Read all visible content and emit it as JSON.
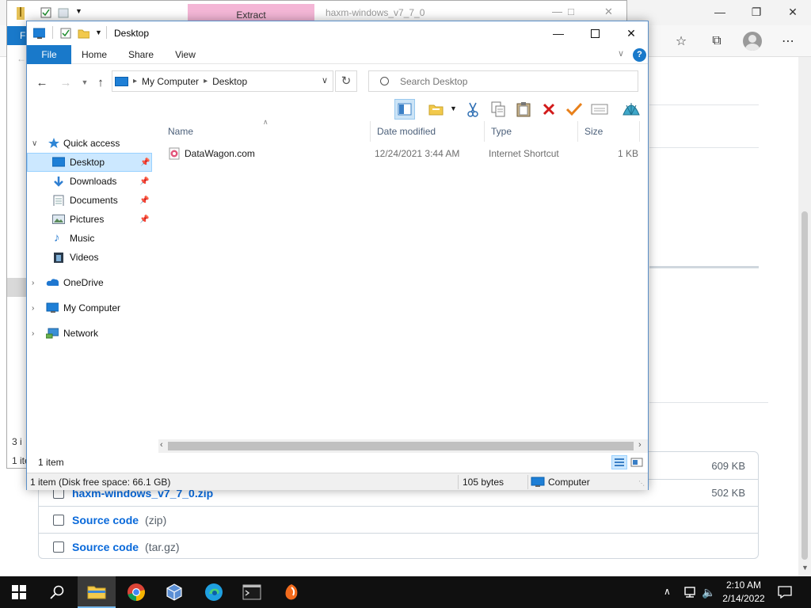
{
  "browser": {
    "assets": [
      {
        "name": "",
        "ext": "",
        "size": "609 KB"
      },
      {
        "name": "haxm-windows_v7_7_0.zip",
        "ext": "",
        "size": "502 KB"
      },
      {
        "name": "Source code",
        "ext": "(zip)",
        "size": ""
      },
      {
        "name": "Source code",
        "ext": "(tar.gz)",
        "size": ""
      }
    ],
    "toolbar_icons": [
      "favorites-star-icon",
      "collections-icon",
      "profile-avatar",
      "more-icon"
    ]
  },
  "back_window": {
    "extract_tab": "Extract",
    "title": "haxm-windows_v7_7_0",
    "file_tab": "F",
    "status_items": "3 i",
    "status_sel": "1 ite"
  },
  "explorer": {
    "title": "Desktop",
    "tabs": {
      "file": "File",
      "home": "Home",
      "share": "Share",
      "view": "View"
    },
    "help": "?",
    "breadcrumb": [
      "My Computer",
      "Desktop"
    ],
    "search_placeholder": "Search Desktop",
    "nav": {
      "quick_access": "Quick access",
      "desktop": "Desktop",
      "downloads": "Downloads",
      "documents": "Documents",
      "pictures": "Pictures",
      "music": "Music",
      "videos": "Videos",
      "onedrive": "OneDrive",
      "my_computer": "My Computer",
      "network": "Network"
    },
    "columns": {
      "name": "Name",
      "date": "Date modified",
      "type": "Type",
      "size": "Size"
    },
    "files": [
      {
        "name": "DataWagon.com",
        "date": "12/24/2021 3:44 AM",
        "type": "Internet Shortcut",
        "size": "1 KB"
      }
    ],
    "item_count": "1 item",
    "status": {
      "summary": "1 item (Disk free space: 66.1 GB)",
      "bytes": "105 bytes",
      "location": "Computer"
    }
  },
  "taskbar": {
    "time": "2:10 AM",
    "date": "2/14/2022",
    "apps": [
      "file-explorer",
      "chrome",
      "virtualbox",
      "edge",
      "terminal",
      "app-orange"
    ]
  },
  "colors": {
    "accent": "#1979ca",
    "selection": "#cce8ff",
    "delete_red": "#d21a1a",
    "check_orange": "#e8801a",
    "extract_pink": "#f4b6d6"
  }
}
